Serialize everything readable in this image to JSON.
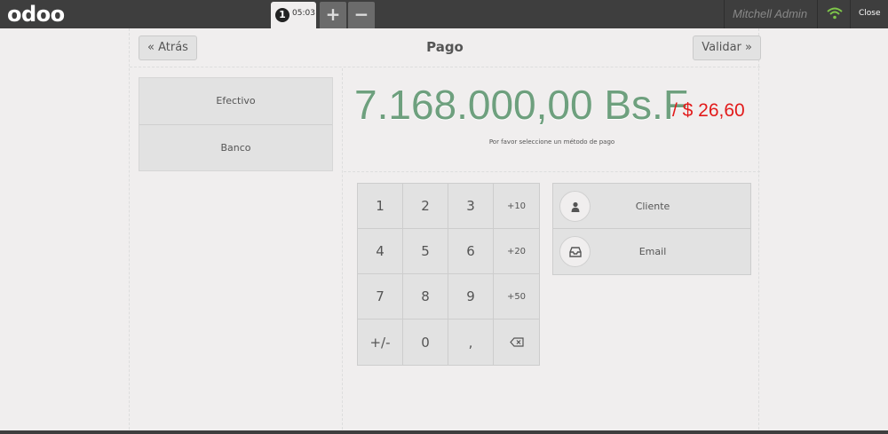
{
  "topbar": {
    "logo": "odoo",
    "order": {
      "number": "1",
      "time": "05:03"
    },
    "add_label": "+",
    "remove_label": "−",
    "user": "Mitchell Admin",
    "close_label": "Close"
  },
  "header": {
    "back_label": "« Atrás",
    "title": "Pago",
    "validate_label": "Validar »"
  },
  "payment_methods": [
    {
      "label": "Efectivo"
    },
    {
      "label": "Banco"
    }
  ],
  "summary": {
    "total": "7.168.000,00 Bs.F",
    "converted": "/ $ 26,60",
    "hint": "Por favor seleccione un método de pago"
  },
  "numpad": {
    "keys": [
      "1",
      "2",
      "3",
      "+10",
      "4",
      "5",
      "6",
      "+20",
      "7",
      "8",
      "9",
      "+50",
      "+/-",
      "0",
      ",",
      ""
    ]
  },
  "customer": {
    "client_label": "Cliente",
    "email_label": "Email"
  },
  "colors": {
    "total": "#6ea07e",
    "converted": "#e21a1a",
    "wifi": "#7ec64a",
    "topbar": "#3e3e3e"
  },
  "icons": [
    "wifi-icon",
    "user-icon",
    "inbox-icon",
    "backspace-icon"
  ]
}
